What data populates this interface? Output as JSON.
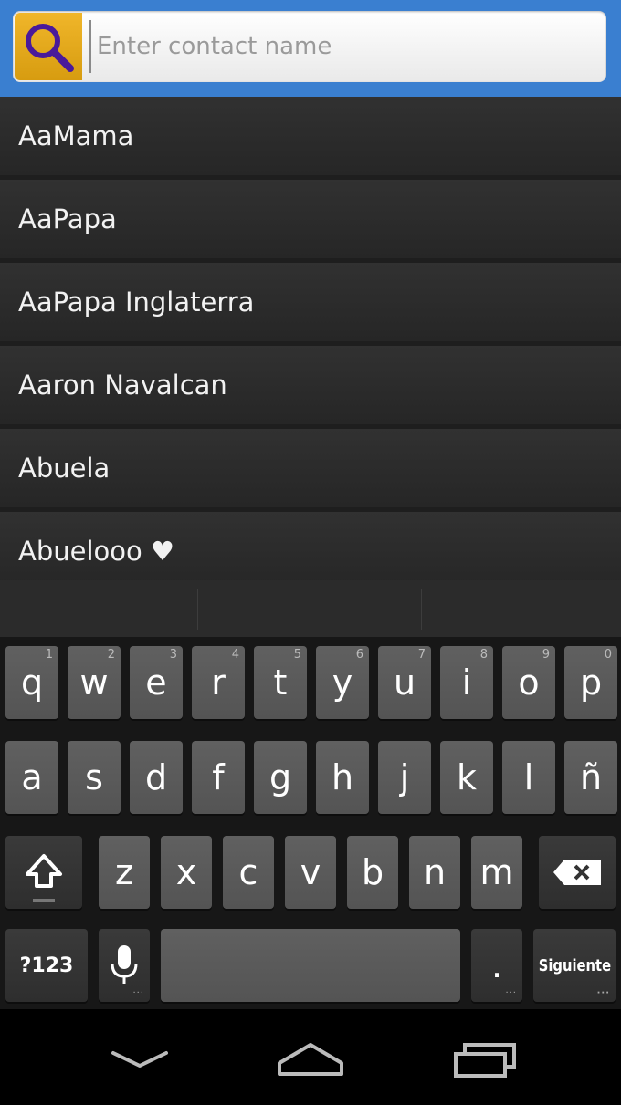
{
  "search": {
    "placeholder": "Enter contact name",
    "value": ""
  },
  "contacts": [
    "AaMama",
    "AaPapa",
    "AaPapa Inglaterra",
    "Aaron Navalcan",
    "Abuela",
    "Abuelooo ♥"
  ],
  "keyboard": {
    "row1": [
      {
        "key": "q",
        "hint": "1"
      },
      {
        "key": "w",
        "hint": "2"
      },
      {
        "key": "e",
        "hint": "3"
      },
      {
        "key": "r",
        "hint": "4"
      },
      {
        "key": "t",
        "hint": "5"
      },
      {
        "key": "y",
        "hint": "6"
      },
      {
        "key": "u",
        "hint": "7"
      },
      {
        "key": "i",
        "hint": "8"
      },
      {
        "key": "o",
        "hint": "9"
      },
      {
        "key": "p",
        "hint": "0"
      }
    ],
    "row2": [
      "a",
      "s",
      "d",
      "f",
      "g",
      "h",
      "j",
      "k",
      "l",
      "ñ"
    ],
    "row3": [
      "z",
      "x",
      "c",
      "v",
      "b",
      "n",
      "m"
    ],
    "symbols_label": "?123",
    "period_label": ".",
    "action_label": "Siguiente"
  },
  "colors": {
    "header": "#3a7fd0",
    "search_icon_bg": "#e6a81a",
    "search_icon": "#4a1a9a",
    "list_bg": "#1e1e1e",
    "key_bg": "#5a5a5a"
  }
}
